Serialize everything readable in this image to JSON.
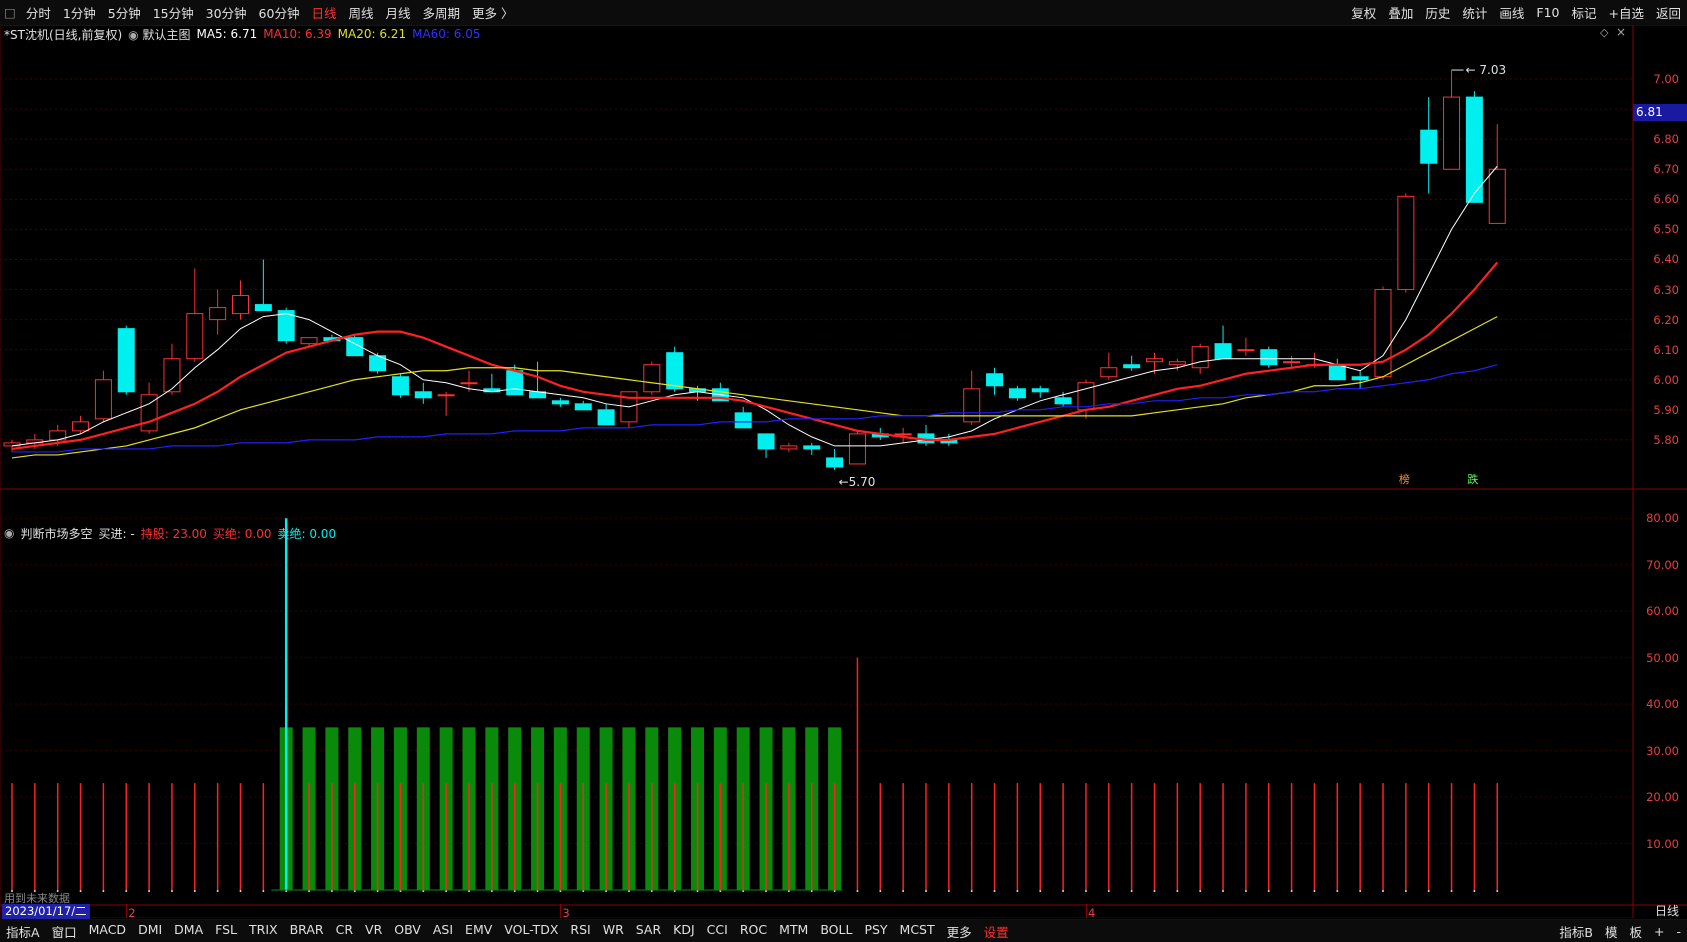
{
  "toolbar": {
    "tabs": [
      "分时",
      "1分钟",
      "5分钟",
      "15分钟",
      "30分钟",
      "60分钟",
      "日线",
      "周线",
      "月线",
      "多周期",
      "更多 〉"
    ],
    "active_tab": "日线",
    "right_items": [
      "复权",
      "叠加",
      "历史",
      "统计",
      "画线",
      "F10",
      "标记",
      "+自选",
      "返回"
    ]
  },
  "main_legend": {
    "title": "*ST沈机(日线,前复权)",
    "template": "默认主图",
    "ma5": "MA5: 6.71",
    "ma10": "MA10: 6.39",
    "ma20": "MA20: 6.21",
    "ma60": "MA60: 6.05"
  },
  "price_axis": {
    "labels": [
      "7.00",
      "6.90",
      "6.80",
      "6.70",
      "6.60",
      "6.50",
      "6.40",
      "6.30",
      "6.20",
      "6.10",
      "6.00",
      "5.90",
      "5.80"
    ],
    "current_price": "6.81"
  },
  "annotations": {
    "high": "7.03",
    "low": "5.70",
    "tag_up": "榜",
    "tag_down": "跌"
  },
  "indicator_legend": {
    "name": "判断市场多空",
    "buy_in": "买进: -",
    "hold": "持股: 23.00",
    "buy_out": "买绝: 0.00",
    "sell_out": "卖绝: 0.00"
  },
  "indicator_axis": {
    "labels": [
      "80.00",
      "70.00",
      "60.00",
      "50.00",
      "40.00",
      "30.00",
      "20.00",
      "10.00"
    ]
  },
  "time_axis": {
    "date_readout": "2023/01/17/二",
    "months": [
      "2",
      "3",
      "4"
    ],
    "future_note": "用到未来数据"
  },
  "bottom_tabs": {
    "left": [
      "指标A",
      "窗口",
      "MACD",
      "DMI",
      "DMA",
      "FSL",
      "TRIX",
      "BRAR",
      "CR",
      "VR",
      "OBV",
      "ASI",
      "EMV",
      "VOL-TDX",
      "RSI",
      "WR",
      "SAR",
      "KDJ",
      "CCI",
      "ROC",
      "MTM",
      "BOLL",
      "PSY",
      "MCST",
      "更多",
      "设置"
    ],
    "right": [
      "指标B",
      "模",
      "板",
      "+",
      "-"
    ],
    "period_button": "日线"
  },
  "colors": {
    "up": "#ff3030",
    "down": "#00f0f0",
    "ma5": "#ffffff",
    "ma10": "#ff2020",
    "ma20": "#e0e020",
    "ma60": "#2020ff",
    "hold_bar": "#0a8a0a"
  },
  "chart_data": [
    {
      "type": "candlestick",
      "title": "*ST沈机(日线,前复权)",
      "ylim": [
        5.65,
        7.08
      ],
      "series": [
        {
          "name": "K线",
          "ohlc": [
            [
              5.78,
              5.8,
              5.76,
              5.79
            ],
            [
              5.79,
              5.82,
              5.77,
              5.8
            ],
            [
              5.8,
              5.85,
              5.78,
              5.83
            ],
            [
              5.83,
              5.88,
              5.82,
              5.86
            ],
            [
              5.87,
              6.03,
              5.86,
              6.0
            ],
            [
              6.17,
              6.18,
              5.95,
              5.96
            ],
            [
              5.83,
              5.99,
              5.82,
              5.95
            ],
            [
              5.96,
              6.12,
              5.95,
              6.07
            ],
            [
              6.07,
              6.37,
              6.06,
              6.22
            ],
            [
              6.2,
              6.3,
              6.15,
              6.24
            ],
            [
              6.22,
              6.33,
              6.2,
              6.28
            ],
            [
              6.25,
              6.4,
              6.24,
              6.23
            ],
            [
              6.23,
              6.24,
              6.12,
              6.13
            ],
            [
              6.12,
              6.14,
              6.11,
              6.14
            ],
            [
              6.14,
              6.15,
              6.13,
              6.13
            ],
            [
              6.14,
              6.15,
              6.08,
              6.08
            ],
            [
              6.08,
              6.09,
              6.02,
              6.03
            ],
            [
              6.01,
              6.02,
              5.94,
              5.95
            ],
            [
              5.96,
              5.99,
              5.92,
              5.94
            ],
            [
              5.95,
              5.96,
              5.88,
              5.95
            ],
            [
              5.99,
              6.03,
              5.96,
              5.99
            ],
            [
              5.97,
              6.02,
              5.96,
              5.96
            ],
            [
              6.03,
              6.05,
              5.96,
              5.95
            ],
            [
              5.96,
              6.06,
              5.95,
              5.94
            ],
            [
              5.93,
              5.94,
              5.91,
              5.92
            ],
            [
              5.92,
              5.93,
              5.9,
              5.9
            ],
            [
              5.9,
              5.92,
              5.86,
              5.85
            ],
            [
              5.86,
              5.96,
              5.84,
              5.96
            ],
            [
              5.96,
              6.06,
              5.95,
              6.05
            ],
            [
              6.09,
              6.11,
              5.96,
              5.97
            ],
            [
              5.97,
              5.98,
              5.93,
              5.96
            ],
            [
              5.97,
              5.99,
              5.93,
              5.93
            ],
            [
              5.89,
              5.91,
              5.84,
              5.84
            ],
            [
              5.82,
              5.82,
              5.74,
              5.77
            ],
            [
              5.77,
              5.79,
              5.76,
              5.78
            ],
            [
              5.78,
              5.79,
              5.75,
              5.77
            ],
            [
              5.74,
              5.77,
              5.7,
              5.71
            ],
            [
              5.72,
              5.83,
              5.72,
              5.82
            ],
            [
              5.82,
              5.84,
              5.8,
              5.81
            ],
            [
              5.82,
              5.84,
              5.79,
              5.82
            ],
            [
              5.82,
              5.85,
              5.78,
              5.79
            ],
            [
              5.8,
              5.82,
              5.78,
              5.79
            ],
            [
              5.86,
              6.03,
              5.85,
              5.97
            ],
            [
              6.02,
              6.04,
              5.95,
              5.98
            ],
            [
              5.97,
              5.98,
              5.93,
              5.94
            ],
            [
              5.97,
              5.98,
              5.94,
              5.96
            ],
            [
              5.94,
              5.96,
              5.91,
              5.92
            ],
            [
              5.9,
              6.0,
              5.87,
              5.99
            ],
            [
              6.01,
              6.09,
              6.0,
              6.04
            ],
            [
              6.05,
              6.08,
              6.03,
              6.04
            ],
            [
              6.06,
              6.09,
              6.02,
              6.07
            ],
            [
              6.05,
              6.07,
              6.03,
              6.06
            ],
            [
              6.04,
              6.12,
              6.02,
              6.11
            ],
            [
              6.12,
              6.18,
              6.1,
              6.07
            ],
            [
              6.1,
              6.14,
              6.08,
              6.1
            ],
            [
              6.1,
              6.11,
              6.04,
              6.05
            ],
            [
              6.06,
              6.08,
              6.04,
              6.06
            ],
            [
              6.05,
              6.09,
              6.04,
              6.05
            ],
            [
              6.05,
              6.07,
              6.0,
              6.0
            ],
            [
              6.01,
              6.03,
              5.97,
              6.0
            ],
            [
              6.01,
              6.31,
              6.0,
              6.3
            ],
            [
              6.3,
              6.62,
              6.29,
              6.61
            ],
            [
              6.83,
              6.94,
              6.62,
              6.72
            ],
            [
              6.7,
              7.03,
              6.7,
              6.94
            ],
            [
              6.94,
              6.96,
              6.59,
              6.59
            ],
            [
              6.52,
              6.85,
              6.52,
              6.7
            ]
          ]
        },
        {
          "name": "MA5",
          "values": [
            5.78,
            5.79,
            5.8,
            5.82,
            5.86,
            5.89,
            5.92,
            5.97,
            6.04,
            6.1,
            6.17,
            6.21,
            6.22,
            6.2,
            6.16,
            6.12,
            6.08,
            6.05,
            6.0,
            5.99,
            5.97,
            5.96,
            5.97,
            5.96,
            5.95,
            5.94,
            5.92,
            5.91,
            5.93,
            5.95,
            5.96,
            5.95,
            5.94,
            5.9,
            5.85,
            5.81,
            5.78,
            5.78,
            5.78,
            5.79,
            5.8,
            5.81,
            5.83,
            5.87,
            5.9,
            5.93,
            5.95,
            5.97,
            5.99,
            6.01,
            6.03,
            6.04,
            6.06,
            6.07,
            6.07,
            6.07,
            6.07,
            6.07,
            6.05,
            6.03,
            6.08,
            6.2,
            6.35,
            6.5,
            6.62,
            6.71
          ]
        },
        {
          "name": "MA10",
          "values": [
            5.77,
            5.78,
            5.79,
            5.8,
            5.82,
            5.84,
            5.86,
            5.89,
            5.92,
            5.96,
            6.01,
            6.05,
            6.09,
            6.11,
            6.13,
            6.15,
            6.16,
            6.16,
            6.14,
            6.11,
            6.08,
            6.05,
            6.03,
            6.01,
            5.98,
            5.96,
            5.95,
            5.94,
            5.94,
            5.94,
            5.94,
            5.94,
            5.93,
            5.91,
            5.89,
            5.87,
            5.85,
            5.83,
            5.82,
            5.81,
            5.8,
            5.8,
            5.81,
            5.82,
            5.84,
            5.86,
            5.88,
            5.9,
            5.91,
            5.93,
            5.95,
            5.97,
            5.98,
            6.0,
            6.02,
            6.03,
            6.04,
            6.05,
            6.05,
            6.05,
            6.06,
            6.1,
            6.15,
            6.22,
            6.3,
            6.39
          ]
        },
        {
          "name": "MA20",
          "values": [
            5.74,
            5.75,
            5.75,
            5.76,
            5.77,
            5.78,
            5.8,
            5.82,
            5.84,
            5.87,
            5.9,
            5.92,
            5.94,
            5.96,
            5.98,
            6.0,
            6.01,
            6.02,
            6.03,
            6.03,
            6.04,
            6.04,
            6.04,
            6.03,
            6.03,
            6.02,
            6.01,
            6.0,
            5.99,
            5.98,
            5.97,
            5.96,
            5.95,
            5.94,
            5.93,
            5.92,
            5.91,
            5.9,
            5.89,
            5.88,
            5.88,
            5.88,
            5.88,
            5.88,
            5.88,
            5.88,
            5.88,
            5.88,
            5.88,
            5.88,
            5.89,
            5.9,
            5.91,
            5.92,
            5.94,
            5.95,
            5.96,
            5.98,
            5.98,
            5.99,
            6.01,
            6.05,
            6.09,
            6.13,
            6.17,
            6.21
          ]
        },
        {
          "name": "MA60",
          "values": [
            5.76,
            5.76,
            5.76,
            5.77,
            5.77,
            5.77,
            5.77,
            5.78,
            5.78,
            5.78,
            5.79,
            5.79,
            5.79,
            5.8,
            5.8,
            5.8,
            5.81,
            5.81,
            5.81,
            5.82,
            5.82,
            5.82,
            5.83,
            5.83,
            5.83,
            5.84,
            5.84,
            5.84,
            5.85,
            5.85,
            5.85,
            5.86,
            5.86,
            5.86,
            5.87,
            5.87,
            5.87,
            5.87,
            5.88,
            5.88,
            5.88,
            5.89,
            5.89,
            5.89,
            5.9,
            5.9,
            5.91,
            5.91,
            5.92,
            5.92,
            5.93,
            5.93,
            5.94,
            5.94,
            5.95,
            5.95,
            5.96,
            5.96,
            5.97,
            5.97,
            5.98,
            5.99,
            6.0,
            6.02,
            6.03,
            6.05
          ]
        }
      ]
    },
    {
      "type": "bar",
      "title": "判断市场多空",
      "ylim": [
        0,
        85
      ],
      "series": [
        {
          "name": "持股",
          "values": [
            0,
            0,
            0,
            0,
            0,
            0,
            0,
            0,
            0,
            0,
            0,
            0,
            35,
            35,
            35,
            35,
            35,
            35,
            35,
            35,
            35,
            35,
            35,
            35,
            35,
            35,
            35,
            35,
            35,
            35,
            35,
            35,
            35,
            35,
            35,
            35,
            35,
            0,
            0,
            0,
            0,
            0,
            0,
            0,
            0,
            0,
            0,
            0,
            0,
            0,
            0,
            0,
            0,
            0,
            0,
            0,
            0,
            0,
            0,
            0,
            0,
            0,
            0,
            0,
            0,
            0
          ]
        },
        {
          "name": "买进",
          "values": [
            23,
            23,
            23,
            23,
            23,
            23,
            23,
            23,
            23,
            23,
            23,
            23,
            80,
            23,
            23,
            23,
            23,
            23,
            23,
            23,
            23,
            23,
            23,
            23,
            23,
            23,
            23,
            23,
            23,
            23,
            23,
            23,
            23,
            23,
            23,
            23,
            23,
            50,
            23,
            23,
            23,
            23,
            23,
            23,
            23,
            23,
            23,
            23,
            23,
            23,
            23,
            23,
            23,
            23,
            23,
            23,
            23,
            23,
            23,
            23,
            23,
            23,
            23,
            23,
            23,
            23
          ]
        }
      ]
    }
  ]
}
